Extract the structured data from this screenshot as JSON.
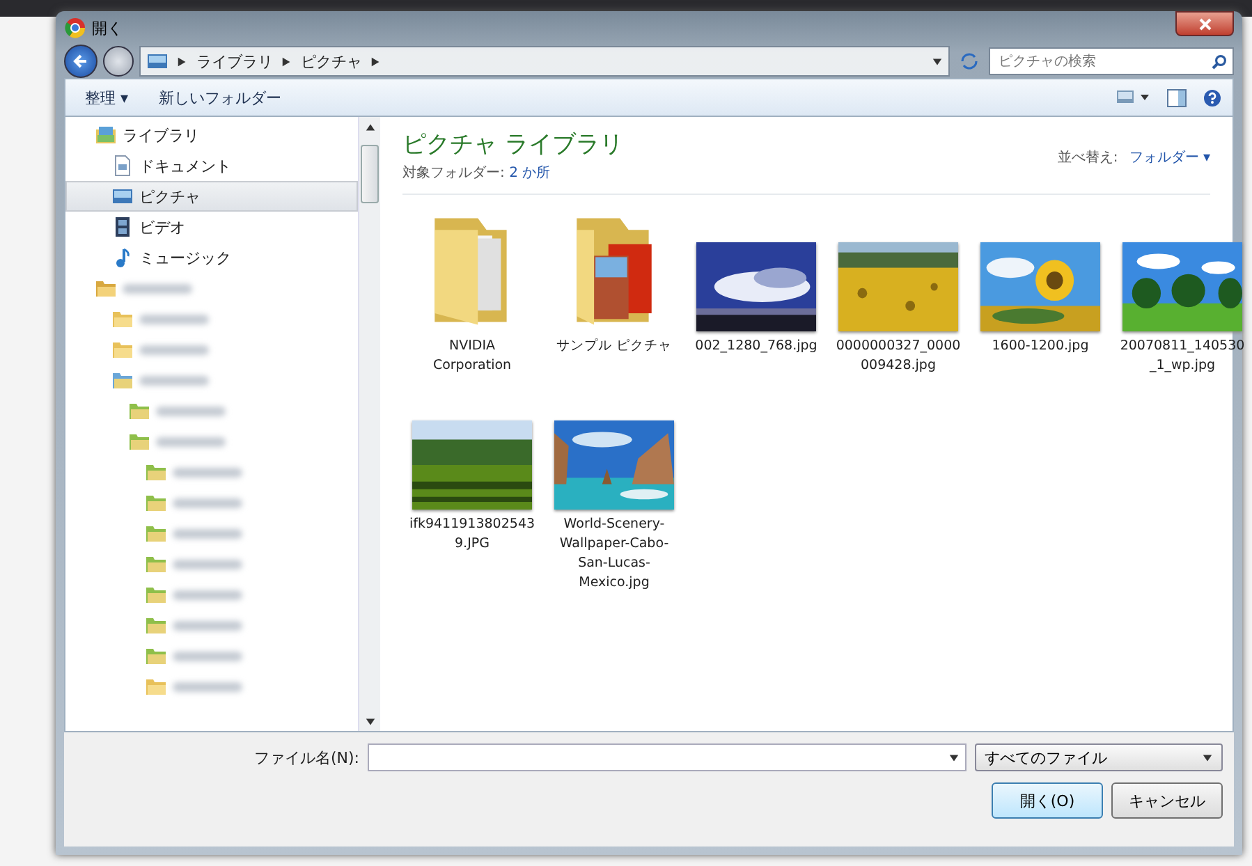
{
  "window": {
    "title": "開く"
  },
  "address_bar": {
    "crumbs": [
      "ライブラリ",
      "ピクチャ"
    ],
    "search": {
      "placeholder": "ピクチャの検索"
    }
  },
  "toolbar": {
    "buttons": [
      "整理 ▾",
      "新しいフォルダー"
    ]
  },
  "sidebar": {
    "items": [
      {
        "kind": "library",
        "label": "ライブラリ",
        "selected": false,
        "children": [
          {
            "kind": "document",
            "label": "ドキュメント",
            "selected": false
          },
          {
            "kind": "picture",
            "label": "ピクチャ",
            "selected": true
          },
          {
            "kind": "video",
            "label": "ビデオ",
            "selected": false
          },
          {
            "kind": "music",
            "label": "ミュージック",
            "selected": false
          }
        ]
      },
      {
        "kind": "user",
        "selected": false,
        "children": [
          {
            "kind": "folder",
            "selected": false
          },
          {
            "kind": "folder",
            "selected": false
          },
          {
            "kind": "shared",
            "selected": false,
            "children": [
              {
                "kind": "green",
                "selected": false
              },
              {
                "kind": "green",
                "selected": false,
                "children": [
                  {
                    "kind": "green",
                    "selected": false
                  },
                  {
                    "kind": "green",
                    "selected": false
                  },
                  {
                    "kind": "green",
                    "selected": false
                  },
                  {
                    "kind": "green",
                    "selected": false
                  },
                  {
                    "kind": "green",
                    "selected": false
                  },
                  {
                    "kind": "green",
                    "selected": false
                  },
                  {
                    "kind": "green",
                    "selected": false
                  },
                  {
                    "kind": "folder",
                    "selected": false
                  }
                ]
              }
            ]
          }
        ]
      }
    ]
  },
  "content": {
    "title": "ピクチャ ライブラリ",
    "subtitle_label": "対象フォルダー:",
    "subtitle_link": "2 か所",
    "sort_label": "並べ替え:",
    "sort_value": "フォルダー ▾",
    "items": [
      {
        "kind": "folder",
        "name": "NVIDIA Corporation"
      },
      {
        "kind": "folder-pictures",
        "name": "サンプル ピクチャ"
      },
      {
        "kind": "picture",
        "name": "002_1280_768.jpg"
      },
      {
        "kind": "picture",
        "name": "0000000327_0000009428.jpg"
      },
      {
        "kind": "picture",
        "name": "1600-1200.jpg"
      },
      {
        "kind": "picture",
        "name": "20070811_140530_1_wp.jpg"
      },
      {
        "kind": "picture",
        "name": "ifk94119138025439.JPG"
      },
      {
        "kind": "picture",
        "name": "World-Scenery-Wallpaper-Cabo-San-Lucas-Mexico.jpg"
      }
    ]
  },
  "footer": {
    "filename_label": "ファイル名(N):",
    "filter": "すべてのファイル",
    "buttons": [
      "開く(O)",
      "キャンセル"
    ]
  }
}
